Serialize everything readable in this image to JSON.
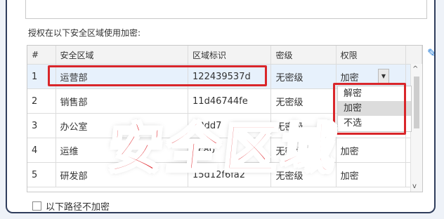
{
  "section_label": "授权在以下安全区域使用加密:",
  "columns": [
    "#",
    "安全区域",
    "区域标识",
    "密级",
    "权限"
  ],
  "rows": [
    {
      "num": "1",
      "region": "运营部",
      "id": "122439537d",
      "level": "无密级",
      "perm": "加密"
    },
    {
      "num": "2",
      "region": "销售部",
      "id": "11d46744fe",
      "level": "无密级",
      "perm": "加密"
    },
    {
      "num": "3",
      "region": "办公室",
      "id": "30dd7",
      "level": "无密级",
      "perm": "选"
    },
    {
      "num": "4",
      "region": "运维",
      "id": "4c80",
      "level": "无密级",
      "perm": "加密"
    },
    {
      "num": "5",
      "region": "研发部",
      "id": "15d12f6fa2",
      "level": "无密级",
      "perm": "加密"
    }
  ],
  "dropdown_options": [
    "解密",
    "加密",
    "不选"
  ],
  "dropdown_selected": "加密",
  "checkbox_label": "以下路径不加密",
  "overlay_text": "安全区域",
  "colors": {
    "highlight": "#d9262a",
    "selected_row": "#e7f1fc",
    "accent": "#1f7ad6",
    "frame": "#2f3d5c"
  },
  "icons": {
    "edit": "pencil-icon",
    "dropdown": "caret-down-icon",
    "scroll_up": "chevron-up-icon",
    "scroll_down": "chevron-down-icon"
  }
}
